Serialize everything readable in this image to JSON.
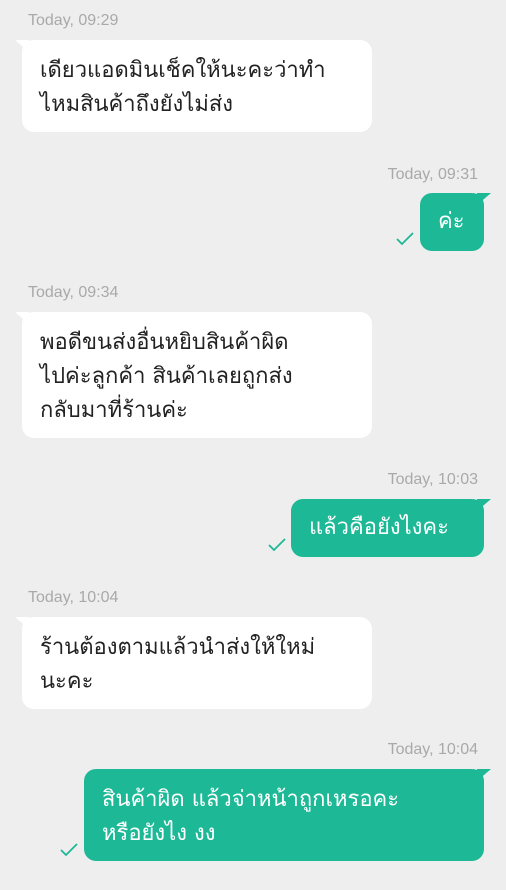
{
  "colors": {
    "background": "#eeeeee",
    "incoming_bubble": "#ffffff",
    "outgoing_bubble": "#1db896",
    "timestamp": "#a9a9a9",
    "check": "#1db896"
  },
  "messages": [
    {
      "direction": "incoming",
      "timestamp": "Today, 09:29",
      "lines": [
        "เดียวแอดมินเช็คให้นะคะว่าทำ",
        "ไหมสินค้าถึงยังไม่ส่ง"
      ]
    },
    {
      "direction": "outgoing",
      "timestamp": "Today, 09:31",
      "lines": [
        "ค่ะ"
      ],
      "status_icon": "check-icon"
    },
    {
      "direction": "incoming",
      "timestamp": "Today, 09:34",
      "lines": [
        "พอดีขนส่งอื่นหยิบสินค้าผิด",
        "ไปค่ะลูกค้า สินค้าเลยถูกส่ง",
        "กลับมาที่ร้านค่ะ"
      ]
    },
    {
      "direction": "outgoing",
      "timestamp": "Today, 10:03",
      "lines": [
        "แล้วคือยังไงคะ"
      ],
      "status_icon": "check-icon"
    },
    {
      "direction": "incoming",
      "timestamp": "Today, 10:04",
      "lines": [
        "ร้านต้องตามแล้วนำส่งให้ใหม่",
        "นะคะ"
      ]
    },
    {
      "direction": "outgoing",
      "timestamp": "Today, 10:04",
      "lines": [
        "สินค้าผิด แล้วจ่าหน้าถูกเหรอคะ",
        "หรือยังไง งง"
      ],
      "status_icon": "check-icon"
    }
  ]
}
